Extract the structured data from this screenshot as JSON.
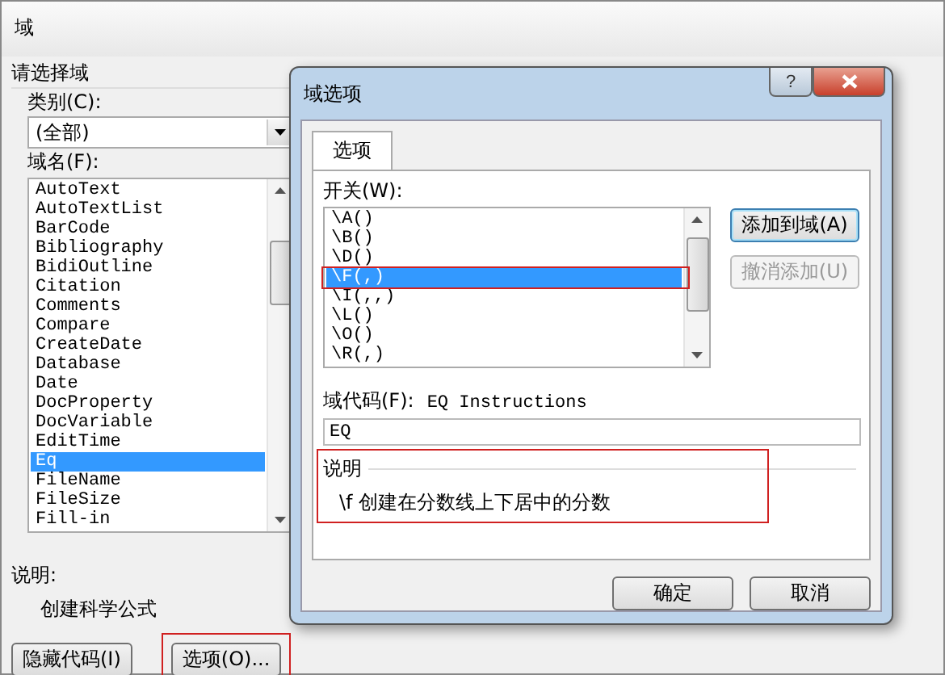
{
  "window": {
    "title": "域"
  },
  "field_panel": {
    "group_title": "请选择域",
    "category_label": "类别(C):",
    "category_value": "(全部)",
    "field_names_label": "域名(F):",
    "field_names": [
      {
        "label": "AutoText",
        "selected": false
      },
      {
        "label": "AutoTextList",
        "selected": false
      },
      {
        "label": "BarCode",
        "selected": false
      },
      {
        "label": "Bibliography",
        "selected": false
      },
      {
        "label": "BidiOutline",
        "selected": false
      },
      {
        "label": "Citation",
        "selected": false
      },
      {
        "label": "Comments",
        "selected": false
      },
      {
        "label": "Compare",
        "selected": false
      },
      {
        "label": "CreateDate",
        "selected": false
      },
      {
        "label": "Database",
        "selected": false
      },
      {
        "label": "Date",
        "selected": false
      },
      {
        "label": "DocProperty",
        "selected": false
      },
      {
        "label": "DocVariable",
        "selected": false
      },
      {
        "label": "EditTime",
        "selected": false
      },
      {
        "label": "Eq",
        "selected": true
      },
      {
        "label": "FileName",
        "selected": false
      },
      {
        "label": "FileSize",
        "selected": false
      },
      {
        "label": "Fill-in",
        "selected": false
      }
    ],
    "description_label": "说明:",
    "description": "创建科学公式"
  },
  "buttons": [
    {
      "label": "隐藏代码(I)",
      "annotated": false
    },
    {
      "label": "选项(O)...",
      "annotated": true
    }
  ],
  "options_dialog": {
    "title": "域选项",
    "help": "?",
    "tabs": [
      {
        "label": "选项",
        "selected": true
      }
    ],
    "switches_label": "开关(W):",
    "switches": [
      {
        "label": "\\A()",
        "selected": false,
        "annotated": false
      },
      {
        "label": "\\B()",
        "selected": false,
        "annotated": false
      },
      {
        "label": "\\D()",
        "selected": false,
        "annotated": false
      },
      {
        "label": "\\F(,)",
        "selected": true,
        "annotated": true
      },
      {
        "label": "\\I(,,)",
        "selected": false,
        "annotated": false
      },
      {
        "label": "\\L()",
        "selected": false,
        "annotated": false
      },
      {
        "label": "\\O()",
        "selected": false,
        "annotated": false
      },
      {
        "label": "\\R(,)",
        "selected": false,
        "annotated": false
      }
    ],
    "side_buttons": [
      {
        "label": "添加到域(A)",
        "disabled": false
      },
      {
        "label": "撤消添加(U)",
        "disabled": true
      }
    ],
    "field_code_label": "域代码(F):",
    "field_code_hint": "EQ Instructions",
    "field_code_value": "EQ",
    "description": {
      "title": "说明",
      "text": "\\f 创建在分数线上下居中的分数",
      "annotated": true
    },
    "buttons": [
      {
        "label": "确定"
      },
      {
        "label": "取消"
      }
    ]
  }
}
